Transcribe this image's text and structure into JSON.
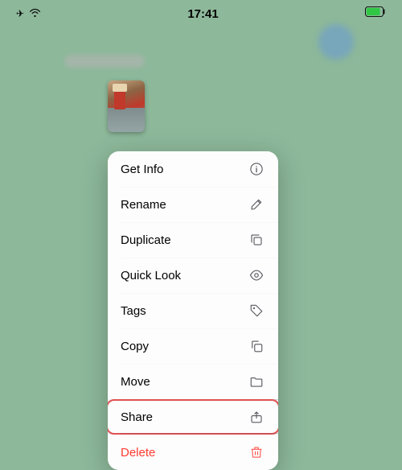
{
  "statusBar": {
    "time": "17:41",
    "icons": {
      "airplane": "✈",
      "wifi": "wifi-icon",
      "battery": "battery-icon"
    }
  },
  "menu": {
    "items": [
      {
        "id": "get-info",
        "label": "Get Info",
        "icon": "info",
        "destructive": false,
        "highlighted": false
      },
      {
        "id": "rename",
        "label": "Rename",
        "icon": "pencil",
        "destructive": false,
        "highlighted": false
      },
      {
        "id": "duplicate",
        "label": "Duplicate",
        "icon": "duplicate",
        "destructive": false,
        "highlighted": false
      },
      {
        "id": "quick-look",
        "label": "Quick Look",
        "icon": "eye",
        "destructive": false,
        "highlighted": false
      },
      {
        "id": "tags",
        "label": "Tags",
        "icon": "tag",
        "destructive": false,
        "highlighted": false
      },
      {
        "id": "copy",
        "label": "Copy",
        "icon": "copy",
        "destructive": false,
        "highlighted": false
      },
      {
        "id": "move",
        "label": "Move",
        "icon": "folder",
        "destructive": false,
        "highlighted": false
      },
      {
        "id": "share",
        "label": "Share",
        "icon": "share",
        "destructive": false,
        "highlighted": true
      },
      {
        "id": "delete",
        "label": "Delete",
        "icon": "trash",
        "destructive": true,
        "highlighted": false
      }
    ]
  }
}
